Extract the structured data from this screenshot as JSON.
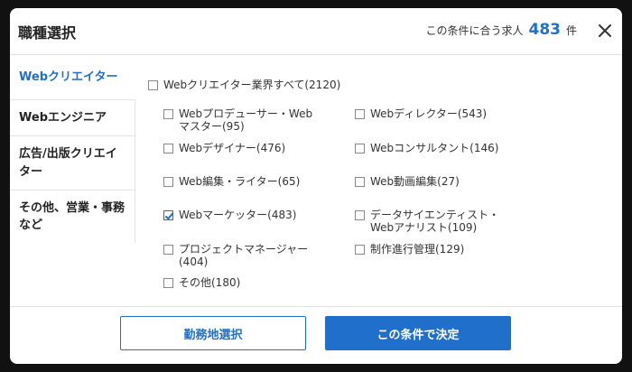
{
  "header": {
    "title": "職種選択",
    "count_prefix": "この条件に合う求人",
    "count_value": "483",
    "count_unit": "件"
  },
  "sidebar": {
    "items": [
      {
        "label": "Webクリエイター",
        "active": true
      },
      {
        "label": "Webエンジニア",
        "active": false
      },
      {
        "label": "広告/出版クリエイター",
        "active": false
      },
      {
        "label": "その他、営業・事務など",
        "active": false
      }
    ]
  },
  "content": {
    "all_label": "Webクリエイター業界すべて(2120)",
    "options": [
      {
        "label": "Webプロデューサー・Webマスター(95)",
        "checked": false
      },
      {
        "label": "Webディレクター(543)",
        "checked": false
      },
      {
        "label": "Webデザイナー(476)",
        "checked": false
      },
      {
        "label": "Webコンサルタント(146)",
        "checked": false
      },
      {
        "label": "Web編集・ライター(65)",
        "checked": false
      },
      {
        "label": "Web動画編集(27)",
        "checked": false
      },
      {
        "label": "Webマーケッター(483)",
        "checked": true
      },
      {
        "label": "データサイエンティスト・Webアナリスト(109)",
        "checked": false
      },
      {
        "label": "プロジェクトマネージャー(404)",
        "checked": false
      },
      {
        "label": "制作進行管理(129)",
        "checked": false
      },
      {
        "label": "その他(180)",
        "checked": false
      }
    ]
  },
  "footer": {
    "area_button": "勤務地選択",
    "confirm_button": "この条件で決定"
  },
  "colors": {
    "accent": "#1f6fcb",
    "overlay": "#111111"
  }
}
